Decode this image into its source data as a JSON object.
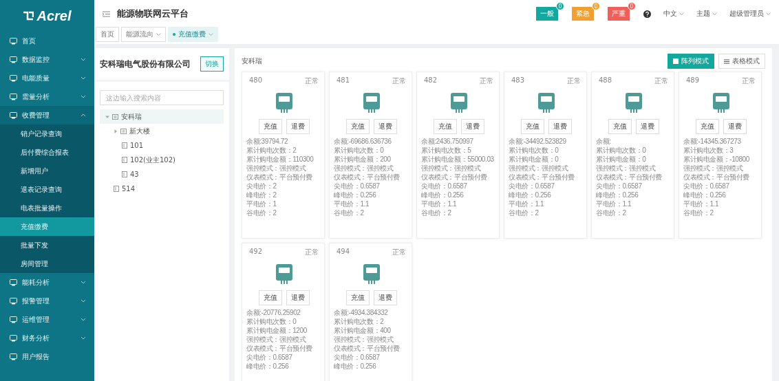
{
  "logo": {
    "text": "Acrel"
  },
  "sidebar": {
    "items": [
      {
        "label": "首页"
      },
      {
        "label": "数据监控",
        "expanded": false
      },
      {
        "label": "电能质量",
        "expanded": false
      },
      {
        "label": "需量分析",
        "expanded": false
      },
      {
        "label": "收费管理",
        "expanded": true,
        "children": [
          {
            "label": "销户记录查询",
            "selected": false
          },
          {
            "label": "后付费综合报表",
            "selected": false
          },
          {
            "label": "新增用户",
            "selected": false
          },
          {
            "label": "退表记录查询",
            "selected": false
          },
          {
            "label": "电表批量操作",
            "selected": false
          },
          {
            "label": "充值缴费",
            "selected": true
          },
          {
            "label": "批量下发",
            "selected": false
          },
          {
            "label": "房间管理",
            "selected": false
          }
        ]
      },
      {
        "label": "能耗分析",
        "expanded": false
      },
      {
        "label": "报警管理",
        "expanded": false
      },
      {
        "label": "运维管理",
        "expanded": false
      },
      {
        "label": "财务分析",
        "expanded": false
      },
      {
        "label": "用户报告"
      }
    ]
  },
  "header": {
    "title": "能源物联网云平台",
    "alerts": [
      {
        "label": "一般",
        "count": "0",
        "color": "#13a89e"
      },
      {
        "label": "紧急",
        "count": "0",
        "color": "#f0a030"
      },
      {
        "label": "严重",
        "count": "0",
        "color": "#f0605a"
      }
    ],
    "menus": [
      "中文",
      "主题",
      "超级管理员"
    ]
  },
  "tabs": [
    {
      "label": "首页",
      "selected": false,
      "closable": false
    },
    {
      "label": "能源流向",
      "selected": false,
      "closable": true
    },
    {
      "label": "充值缴费",
      "selected": true,
      "closable": true
    }
  ],
  "tree_panel": {
    "title": "安科瑞电气股份有限公司",
    "switch_button": "切换",
    "search": {
      "placeholder": "这边输入搜索内容"
    },
    "tree": [
      {
        "label": "安科瑞",
        "kind": "folder",
        "expanded": true,
        "selected": true,
        "children": [
          {
            "label": "新大楼",
            "kind": "folder",
            "expanded": false,
            "selected": false
          },
          {
            "label": "101",
            "kind": "meter",
            "selected": false
          },
          {
            "label": "102(业主102)",
            "kind": "meter",
            "selected": false
          },
          {
            "label": "43",
            "kind": "meter",
            "selected": false
          }
        ]
      },
      {
        "label": "514",
        "kind": "meter",
        "selected": false
      }
    ]
  },
  "meters_panel": {
    "title": "安科瑞",
    "view_modes": [
      {
        "label": "阵列模式",
        "selected": true
      },
      {
        "label": "表格模式",
        "selected": false
      }
    ],
    "cards": [
      {
        "id": "480",
        "status": "正常",
        "buttons": [
          "充值",
          "退费"
        ],
        "lines": [
          "余额:39794.72",
          "累计购电次数：2",
          "累计购电金额：110300",
          "强控模式：强控模式",
          "仪表模式：平台预付费",
          "尖电价：2",
          "峰电价：2",
          "平电价：1",
          "谷电价：2"
        ]
      },
      {
        "id": "481",
        "status": "正常",
        "buttons": [
          "充值",
          "退费"
        ],
        "lines": [
          "余额:-69686.636736",
          "累计购电次数：0",
          "累计购电金额：200",
          "强控模式：强控模式",
          "仪表模式：平台预付费",
          "尖电价：0.6587",
          "峰电价：0.256",
          "平电价：1.1",
          "谷电价：2"
        ]
      },
      {
        "id": "482",
        "status": "正常",
        "buttons": [
          "充值",
          "退费"
        ],
        "lines": [
          "余额:2436.750997",
          "累计购电次数：5",
          "累计购电金额：55000.03",
          "强控模式：强控模式",
          "仪表模式：平台预付费",
          "尖电价：0.6587",
          "峰电价：0.256",
          "平电价：1.1",
          "谷电价：2"
        ]
      },
      {
        "id": "483",
        "status": "正常",
        "buttons": [
          "充值",
          "退费"
        ],
        "lines": [
          "余额:-34492.523829",
          "累计购电次数：0",
          "累计购电金额：0",
          "强控模式：强控模式",
          "仪表模式：平台预付费",
          "尖电价：0.6587",
          "峰电价：0.256",
          "平电价：1.1",
          "谷电价：2"
        ]
      },
      {
        "id": "488",
        "status": "正常",
        "buttons": [
          "充值",
          "退费"
        ],
        "lines": [
          "余额:",
          "累计购电次数：0",
          "累计购电金额：0",
          "强控模式：强控模式",
          "仪表模式：平台预付费",
          "尖电价：0.6587",
          "峰电价：0.256",
          "平电价：1.1",
          "谷电价：2"
        ]
      },
      {
        "id": "489",
        "status": "正常",
        "buttons": [
          "充值",
          "退费"
        ],
        "lines": [
          "余额:-14345.367273",
          "累计购电次数：3",
          "累计购电金额：-10800",
          "强控模式：强控模式",
          "仪表模式：平台预付费",
          "尖电价：0.6587",
          "峰电价：0.256",
          "平电价：1.1",
          "谷电价：2"
        ]
      },
      {
        "id": "492",
        "status": "正常",
        "buttons": [
          "充值",
          "退费"
        ],
        "lines": [
          "余额:-20776.25902",
          "累计购电次数：0",
          "累计购电金额：1200",
          "强控模式：强控模式",
          "仪表模式：平台预付费",
          "尖电价：0.6587",
          "峰电价：0.256"
        ]
      },
      {
        "id": "494",
        "status": "正常",
        "buttons": [
          "充值",
          "退费"
        ],
        "lines": [
          "余额:-4934.384332",
          "累计购电次数：2",
          "累计购电金额：400",
          "强控模式：强控模式",
          "仪表模式：平台预付费",
          "尖电价：0.6587",
          "峰电价：0.256"
        ]
      }
    ]
  }
}
